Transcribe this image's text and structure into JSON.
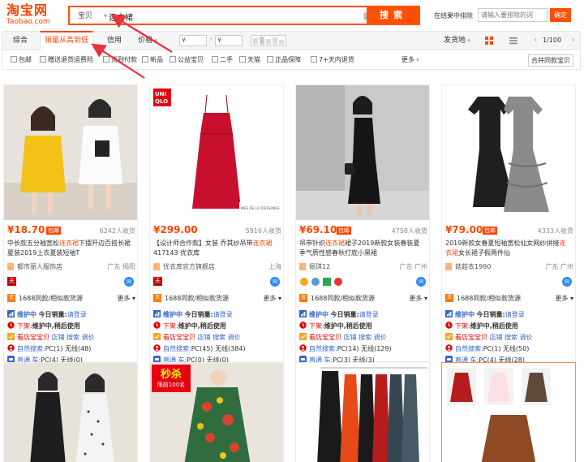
{
  "header": {
    "logo_cn": "淘宝网",
    "logo_en": "Taobao.com",
    "scope_label": "宝贝",
    "query": "连衣裙",
    "search_label": "搜索",
    "exclude_label": "在结果中排除",
    "exclude_placeholder": "请输入要排除的词",
    "exclude_button": "确定"
  },
  "sortbar": {
    "items": [
      "综合",
      "销量从高到低",
      "信用",
      "价格"
    ],
    "active_index": 1,
    "price_from": "¥",
    "price_to": "¥",
    "price_dash": "-",
    "ship_from": "发货地",
    "page": "1/100",
    "prev": "‹",
    "next": "›"
  },
  "filters": {
    "items": [
      "包邮",
      "赠送退货运费险",
      "货到付款",
      "新品",
      "公益宝贝",
      "二手",
      "天猫",
      "正品保障",
      "7+天内退货"
    ],
    "more": "更多",
    "merge": "合并同款宝贝"
  },
  "colors": {
    "brand": "#ff4400",
    "search_orange": "#ff5000",
    "link_blue": "#3366cc",
    "arrow_red": "#e8323c"
  },
  "products": [
    {
      "price": "¥18.70",
      "badge": "包邮",
      "paid": "6242人收货",
      "title_pre": "中长款五分袖宽松",
      "title_hl": "连衣裙",
      "title_post": "下摆开边百搭长裙夏装2019上衣夏装短袖T",
      "shop": "都市丽人服饰店",
      "location": "广东 揭阳",
      "source_text": "1688同款/相似款货源",
      "source_more": "更多",
      "ext": {
        "line1_a": "维护中",
        "line1_b": "今日销量:",
        "line1_c": "请登录",
        "line2_a": "下架:",
        "line2_b": "维护中,稍后使用",
        "line3_a": "看店宝宝贝",
        "line3_b": "店铺",
        "line3_c": "搜索",
        "line3_d": "调价",
        "line4_a": "自然搜索:",
        "line4_b": "PC(1)",
        "line4_c": "无线(48)",
        "line5_a": "直通 车:",
        "line5_b": "PC(4)",
        "line5_c": "无线(0)"
      }
    },
    {
      "price": "¥299.00",
      "badge": "",
      "paid": "5916人收货",
      "title_pre": "【设计师合作款】女装 乔其纱吊带",
      "title_hl": "连衣裙",
      "title_post": " 417143 优衣库",
      "shop": "优衣库官方旗舰店",
      "location": "上海",
      "source_text": "1688同款/相似款货源",
      "source_more": "更多",
      "ext": {
        "line1_a": "维护中",
        "line1_b": "今日销量:",
        "line1_c": "请登录",
        "line2_a": "下架:",
        "line2_b": "维护中,稍后使用",
        "line3_a": "看店宝宝贝",
        "line3_b": "店铺",
        "line3_c": "搜索",
        "line3_d": "调价",
        "line4_a": "自然搜索:",
        "line4_b": "PC(45)",
        "line4_c": "无线(384)",
        "line5_a": "直通 车:",
        "line5_b": "PC(0)",
        "line5_c": "无线(0)"
      }
    },
    {
      "price": "¥69.10",
      "badge": "包邮",
      "paid": "4758人收货",
      "title_pre": "吊带针织",
      "title_hl": "连衣裙",
      "title_post": "裙子2019新款女装春装夏季气质性感春秋打底小黑裙",
      "shop": "佩琪12",
      "location": "广东 广州",
      "source_text": "1688同款/相似款货源",
      "source_more": "更多",
      "ext": {
        "line1_a": "维护中",
        "line1_b": "今日销量:",
        "line1_c": "请登录",
        "line2_a": "下架:",
        "line2_b": "维护中,稍后使用",
        "line3_a": "看店宝宝贝",
        "line3_b": "店铺",
        "line3_c": "搜索",
        "line3_d": "调价",
        "line4_a": "自然搜索:",
        "line4_b": "PC(14)",
        "line4_c": "无线(129)",
        "line5_a": "直通 车:",
        "line5_b": "PC(3)",
        "line5_c": "无线(3)"
      }
    },
    {
      "price": "¥79.00",
      "badge": "包邮",
      "paid": "4333人收货",
      "title_pre": "2019新款女春夏短袖宽松仙女网纱拼接",
      "title_hl": "连衣裙",
      "title_post": "女长裙子假两件仙",
      "shop": "菇菇衣1990",
      "location": "广东 广州",
      "source_text": "1688同款/相似款货源",
      "source_more": "更多",
      "ext": {
        "line1_a": "维护中",
        "line1_b": "今日销量:",
        "line1_c": "请登录",
        "line2_a": "下架:",
        "line2_b": "维护中,稍后使用",
        "line3_a": "看店宝宝贝",
        "line3_b": "店铺",
        "line3_c": "搜索",
        "line3_d": "调价",
        "line4_a": "自然搜索:",
        "line4_b": "PC(1)",
        "line4_c": "无线(50)",
        "line5_a": "直通 车:",
        "line5_b": "PC(4)",
        "line5_c": "无线(28)"
      }
    }
  ],
  "row2": {
    "promo_big": "秒杀",
    "promo_small": "限前100名"
  }
}
